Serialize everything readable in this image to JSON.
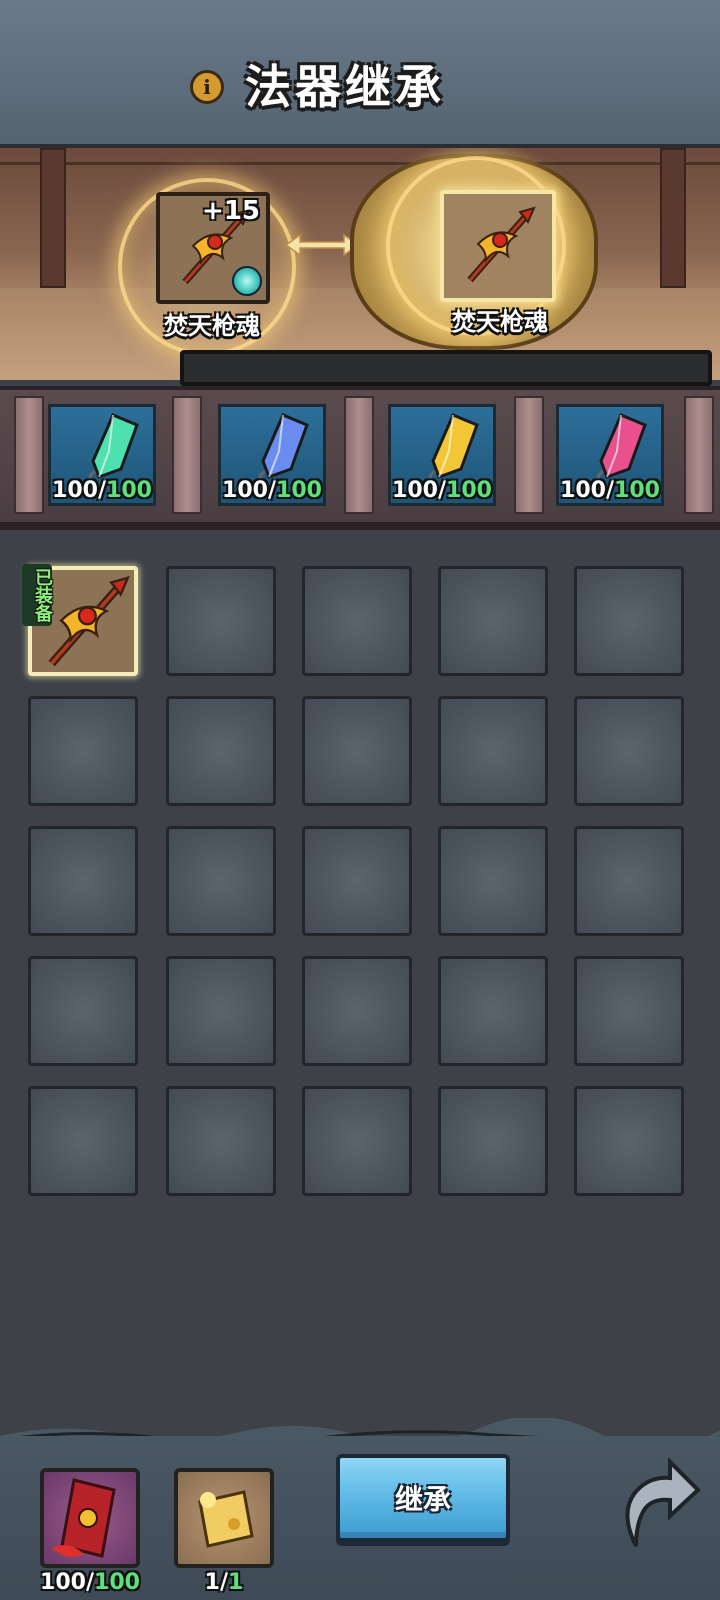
{
  "header": {
    "title": "法器继承",
    "info_icon": "info-icon"
  },
  "stage": {
    "source": {
      "name": "焚天枪魂",
      "level": "+15",
      "icon": "spear-icon",
      "badge_icon": "spirit-flame-icon"
    },
    "target": {
      "name": "焚天枪魂",
      "icon": "spear-icon"
    },
    "progress": 0
  },
  "materials": [
    {
      "icon": "green-crystal-icon",
      "color": "#4fe0b0",
      "current": "100/",
      "max": "100"
    },
    {
      "icon": "blue-crystal-icon",
      "color": "#6a8cf0",
      "current": "100/",
      "max": "100"
    },
    {
      "icon": "yellow-crystal-icon",
      "color": "#f2c636",
      "current": "100/",
      "max": "100"
    },
    {
      "icon": "pink-crystal-icon",
      "color": "#e8508e",
      "current": "100/",
      "max": "100"
    }
  ],
  "inventory": {
    "columns": 5,
    "rows": 5,
    "items": [
      {
        "icon": "spear-icon",
        "tag": "已装备"
      }
    ]
  },
  "bottom": {
    "resources": [
      {
        "icon": "scroll-talisman-icon",
        "current": "100/",
        "max": "100"
      },
      {
        "icon": "golden-scroll-icon",
        "current": "1/",
        "max": "1"
      }
    ],
    "inherit_label": "继承",
    "back_icon": "back-arrow-icon"
  }
}
